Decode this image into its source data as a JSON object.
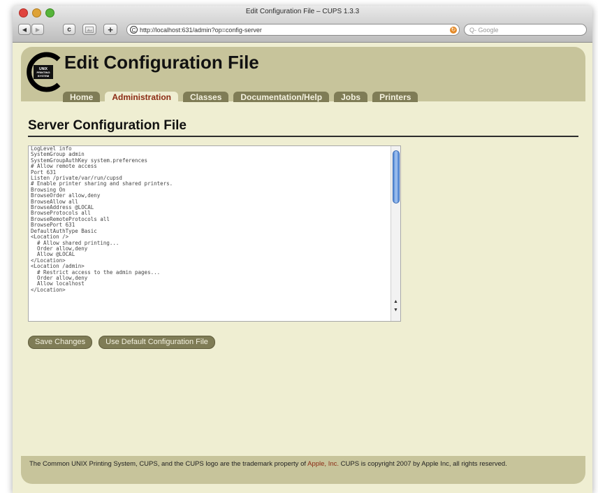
{
  "browser": {
    "window_title": "Edit Configuration File – CUPS 1.3.3",
    "url": "http://localhost:631/admin?op=config-server",
    "search_placeholder": "Q- Google",
    "back_glyph": "◀",
    "forward_glyph": "▶",
    "reload_glyph": "c",
    "add_glyph": "+",
    "url_icon_glyph": "C",
    "icons": [
      "back-icon",
      "forward-icon",
      "reload-icon",
      "screenshot-icon",
      "add-bookmark-icon",
      "search-icon"
    ]
  },
  "header": {
    "logo_text": "UNIX PRINTING SYSTEM",
    "page_title": "Edit Configuration File",
    "tabs": [
      {
        "label": "Home",
        "active": false
      },
      {
        "label": "Administration",
        "active": true
      },
      {
        "label": "Classes",
        "active": false
      },
      {
        "label": "Documentation/Help",
        "active": false
      },
      {
        "label": "Jobs",
        "active": false
      },
      {
        "label": "Printers",
        "active": false
      }
    ]
  },
  "main": {
    "section_title": "Server Configuration File",
    "config_text": "LogLevel info\nSystemGroup admin\nSystemGroupAuthKey system.preferences\n# Allow remote access\nPort 631\nListen /private/var/run/cupsd\n# Enable printer sharing and shared printers.\nBrowsing On\nBrowseOrder allow,deny\nBrowseAllow all\nBrowseAddress @LOCAL\nBrowseProtocols all\nBrowseRemoteProtocols all\nBrowsePort 631\nDefaultAuthType Basic\n<Location />\n  # Allow shared printing...\n  Order allow,deny\n  Allow @LOCAL\n</Location>\n<Location /admin>\n  # Restrict access to the admin pages...\n  Order allow,deny\n  Allow localhost\n</Location>",
    "save_button": "Save Changes",
    "default_button": "Use Default Configuration File"
  },
  "footer": {
    "text_before": "The Common UNIX Printing System, CUPS, and the CUPS logo are the trademark property of ",
    "apple_link": "Apple, Inc.",
    "text_after": " CUPS is copyright 2007 by Apple Inc, all rights reserved."
  },
  "colors": {
    "page_bg": "#efeed2",
    "header_bg": "#c7c49b",
    "tab_bg": "#7f7c56",
    "active_tab_text": "#8b2a13",
    "link": "#8b2a13"
  }
}
